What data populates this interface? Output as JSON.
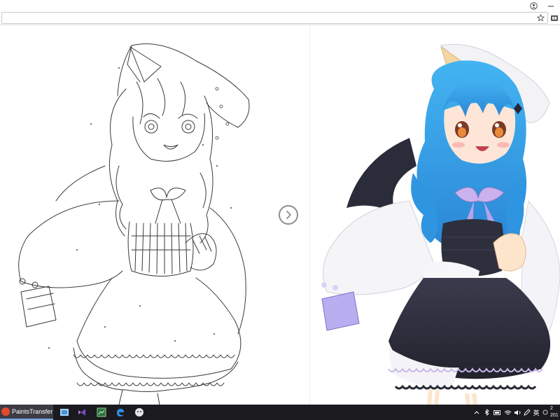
{
  "browser": {
    "url": ""
  },
  "taskbar": {
    "active_window_label": "PaintsTransfer - ...",
    "ime_label": "英",
    "clock": {
      "line1": "2",
      "line2": "201"
    }
  },
  "icons": {
    "account": "account-circle-icon",
    "minimize": "minimize-icon",
    "bookmark": "star-icon",
    "extension": "extension-icon",
    "next": "chevron-right-icon"
  },
  "colors": {
    "hair": "#3aa6e8",
    "taskbar": "#1b1b1f",
    "button_ring": "#8e8e8e"
  }
}
